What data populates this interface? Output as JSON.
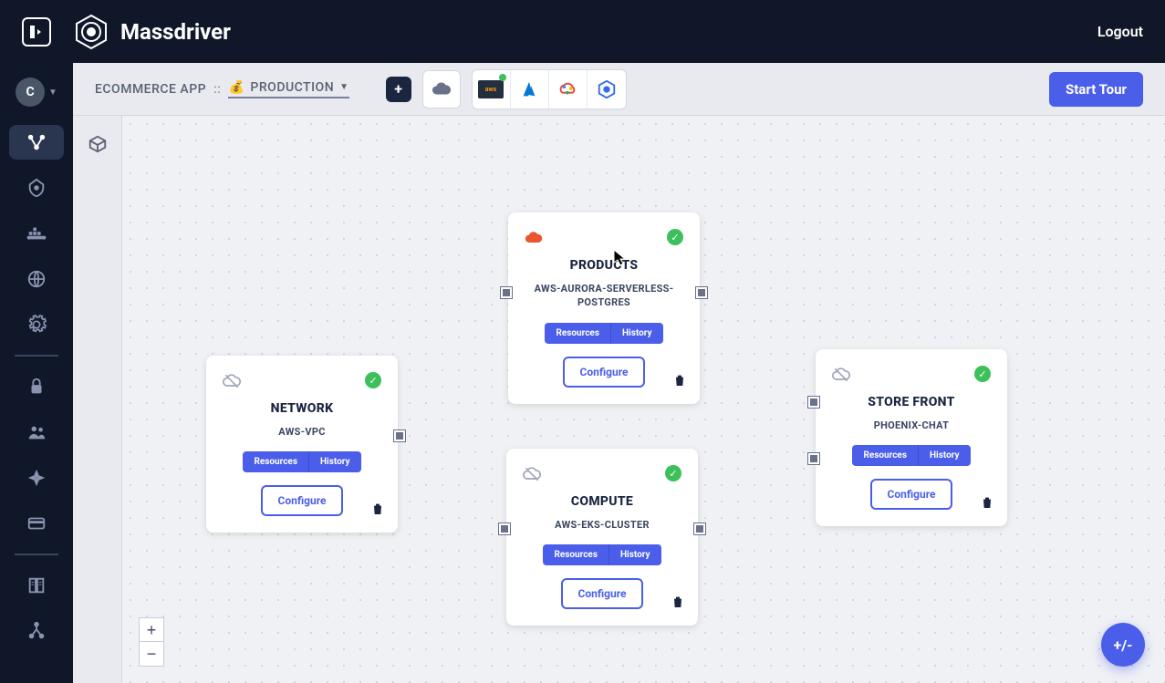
{
  "brand": {
    "name": "Massdriver"
  },
  "header": {
    "logout": "Logout"
  },
  "sidebar": {
    "avatar": "C"
  },
  "toolbar": {
    "app": "ECOMMERCE APP",
    "sep": "::",
    "env_emoji": "💰",
    "env": "PRODUCTION",
    "start_tour": "Start Tour"
  },
  "zoom": {
    "in": "+",
    "out": "−"
  },
  "fab": {
    "label": "+/-"
  },
  "nodes": {
    "network": {
      "title": "NETWORK",
      "sub": "AWS-VPC",
      "resources": "Resources",
      "history": "History",
      "configure": "Configure"
    },
    "products": {
      "title": "PRODUCTS",
      "sub": "AWS-AURORA-SERVERLESS-POSTGRES",
      "resources": "Resources",
      "history": "History",
      "configure": "Configure"
    },
    "compute": {
      "title": "COMPUTE",
      "sub": "AWS-EKS-CLUSTER",
      "resources": "Resources",
      "history": "History",
      "configure": "Configure"
    },
    "storefront": {
      "title": "STORE FRONT",
      "sub": "PHOENIX-CHAT",
      "resources": "Resources",
      "history": "History",
      "configure": "Configure"
    }
  }
}
